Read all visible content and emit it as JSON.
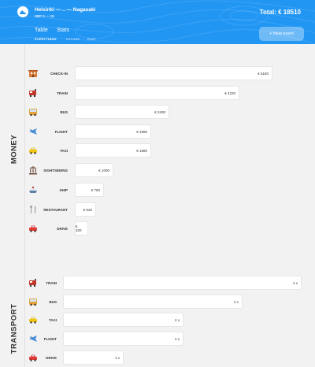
{
  "header": {
    "trip_title": "Helsinki — .. — Nagasaki",
    "dates": "SEP 3 — 15",
    "total": "Total: € 18510",
    "tabs": [
      "Table",
      "Stats"
    ],
    "filters": [
      "EVERYTHING",
      "FUTURE",
      "PAST"
    ],
    "active_filter": "EVERYTHING",
    "new_event_label": "+ New event"
  },
  "money": {
    "section_label": "MONEY",
    "items": [
      {
        "label": "CHECK-IN",
        "value": "€ 5150",
        "icon": "hotel-icon",
        "amount": 5150
      },
      {
        "label": "TRAIN",
        "value": "€ 4220",
        "icon": "train-icon",
        "amount": 4220
      },
      {
        "label": "BUS",
        "value": "€ 2400",
        "icon": "bus-icon",
        "amount": 2400
      },
      {
        "label": "FLIGHT",
        "value": "€ 1990",
        "icon": "airplane-icon",
        "amount": 1990
      },
      {
        "label": "TAXI",
        "value": "€ 1980",
        "icon": "taxi-icon",
        "amount": 1980
      },
      {
        "label": "SIGHTSEEING",
        "value": "€ 1000",
        "icon": "museum-icon",
        "amount": 1000
      },
      {
        "label": "SHIP",
        "value": "€ 750",
        "icon": "ship-icon",
        "amount": 750
      },
      {
        "label": "RESTAURANT",
        "value": "€ 520",
        "icon": "fork-knife-icon",
        "amount": 520
      },
      {
        "label": "DRIVE",
        "value": "€ 320",
        "icon": "car-icon",
        "amount": 320
      }
    ]
  },
  "transport": {
    "section_label": "TRANSPORT",
    "items": [
      {
        "label": "TRAIN",
        "value": "4 x",
        "icon": "train-icon",
        "count": 4
      },
      {
        "label": "BUS",
        "value": "3 x",
        "icon": "bus-icon",
        "count": 3
      },
      {
        "label": "TAXI",
        "value": "2 x",
        "icon": "taxi-icon",
        "count": 2
      },
      {
        "label": "FLIGHT",
        "value": "2 x",
        "icon": "airplane-icon",
        "count": 2
      },
      {
        "label": "DRIVE",
        "value": "1 x",
        "icon": "car-icon",
        "count": 1
      }
    ]
  },
  "colors": {
    "header": "#2196f3",
    "page": "#f2f2f2"
  }
}
